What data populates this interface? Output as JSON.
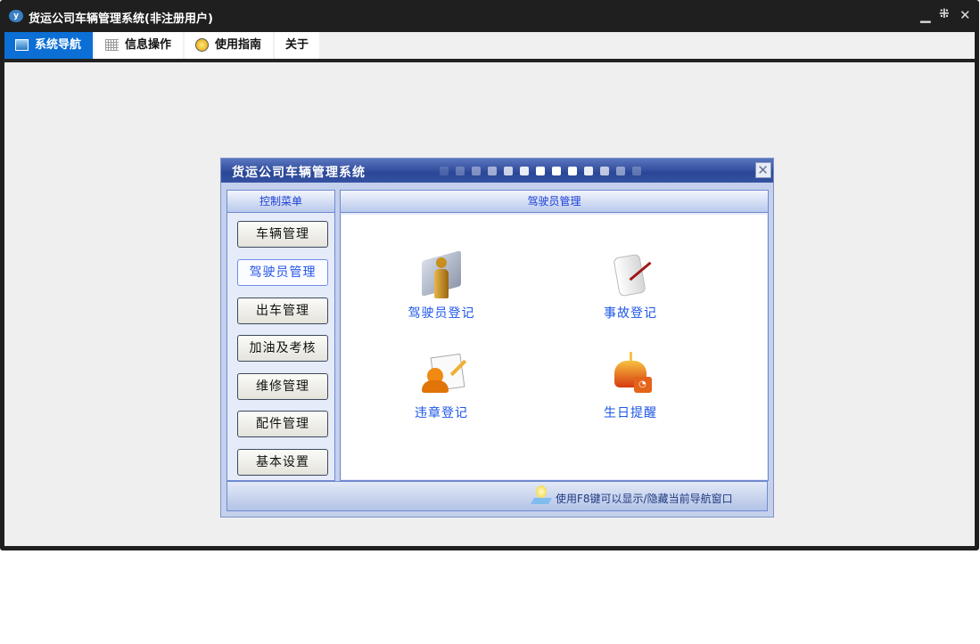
{
  "window": {
    "title": "货运公司车辆管理系统(非注册用户)",
    "logo_text": "y"
  },
  "tabs": [
    {
      "label": "系统导航",
      "icon": "monitor-icon",
      "active": true
    },
    {
      "label": "信息操作",
      "icon": "grid-icon",
      "active": false
    },
    {
      "label": "使用指南",
      "icon": "help-icon",
      "active": false
    },
    {
      "label": "关于",
      "icon": "",
      "active": false
    }
  ],
  "dialog": {
    "title": "货运公司车辆管理系统",
    "left_header": "控制菜单",
    "right_header": "驾驶员管理",
    "menu": [
      "车辆管理",
      "驾驶员管理",
      "出车管理",
      "加油及考核",
      "维修管理",
      "配件管理",
      "基本设置"
    ],
    "selected_menu": "驾驶员管理",
    "items": [
      {
        "label": "驾驶员登记",
        "icon": "driver-icon"
      },
      {
        "label": "事故登记",
        "icon": "scroll-pen-icon"
      },
      {
        "label": "违章登记",
        "icon": "user-document-icon"
      },
      {
        "label": "生日提醒",
        "icon": "cake-icon"
      }
    ],
    "footer_tip": "使用F8键可以显示/隐藏当前导航窗口"
  },
  "colors": {
    "active_tab": "#0b6fd6",
    "dialog_title": "#2a4696",
    "link": "#1c55e8"
  }
}
